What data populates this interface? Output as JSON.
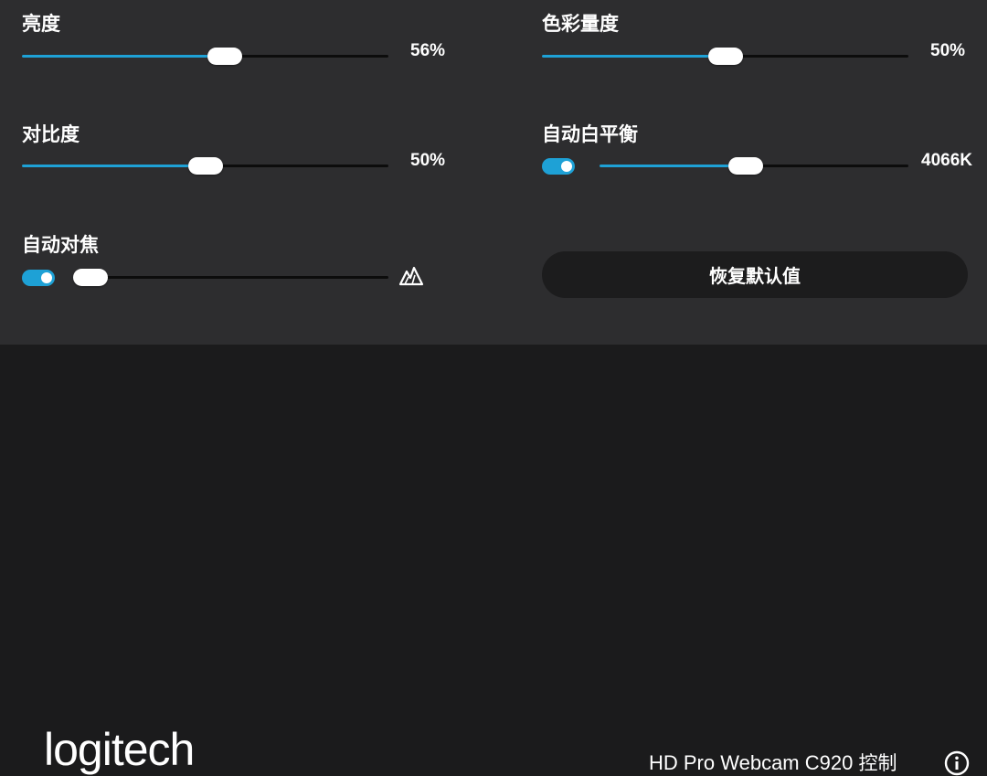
{
  "controls": {
    "brightness": {
      "label": "亮度",
      "value_text": "56%",
      "fraction": 0.56
    },
    "saturation": {
      "label": "色彩量度",
      "value_text": "50%",
      "fraction": 0.5
    },
    "contrast": {
      "label": "对比度",
      "value_text": "50%",
      "fraction": 0.5
    },
    "white_balance": {
      "label": "自动白平衡",
      "value_text": "4066K",
      "fraction": 0.47,
      "auto_enabled": true
    },
    "autofocus": {
      "label": "自动对焦",
      "fraction": 0.0,
      "auto_enabled": true,
      "icon": "mountain-focus-icon"
    }
  },
  "reset_button": {
    "label": "恢复默认值"
  },
  "footer": {
    "logo": "logitech",
    "model": "HD Pro Webcam C920",
    "model_suffix": "控制",
    "info_icon": "info-icon"
  },
  "colors": {
    "accent": "#1ea1d6",
    "panel": "#2d2d2f",
    "footer": "#1b1b1c",
    "button": "#1c1c1d"
  }
}
